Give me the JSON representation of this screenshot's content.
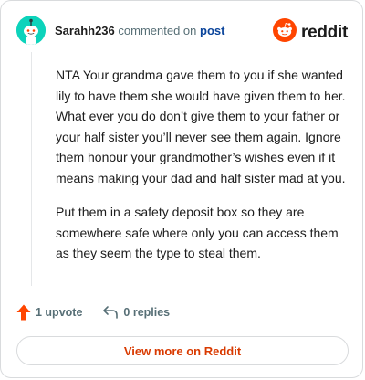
{
  "comment": {
    "username": "Sarahh236",
    "commented_on": "commented on",
    "post_link": "post",
    "paragraphs": [
      "NTA Your grandma gave them to you if she wanted lily to have them she would have given them to her. What ever you do don’t give them to your father or your half sister you’ll never see them again. Ignore them honour your grandmother’s wishes even if it means making your dad and half sister mad at you.",
      "Put them in a safety deposit box so they are somewhere safe where only you can access them as they seem the type to steal them."
    ]
  },
  "brand": {
    "text": "reddit",
    "color": "#ff4500"
  },
  "actions": {
    "upvote_label": "1 upvote",
    "replies_label": "0 replies",
    "upvote_color": "#ff4500"
  },
  "footer": {
    "view_more_label": "View more on Reddit",
    "accent": "#d93a00"
  },
  "icons": {
    "avatar": "snoo-avatar-icon",
    "brand": "reddit-logo-icon",
    "upvote": "upvote-arrow-icon",
    "reply": "reply-arrow-icon"
  }
}
